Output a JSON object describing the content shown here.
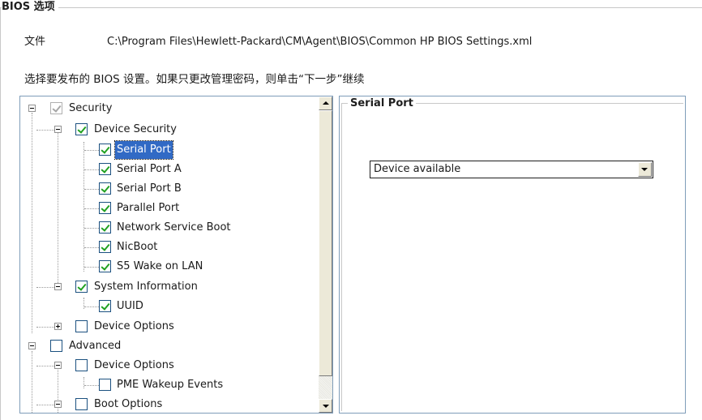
{
  "group_title": "BIOS 选项",
  "file": {
    "label": "文件",
    "path": "C:\\Program Files\\Hewlett-Packard\\CM\\Agent\\BIOS\\Common HP BIOS Settings.xml"
  },
  "instruction": "选择要发布的 BIOS 设置。如果只更改管理密码，则单击“下一步”继续",
  "tree": {
    "items": [
      {
        "label": "Security",
        "checked": true,
        "expanded": true
      },
      {
        "label": "Device Security",
        "checked": true,
        "expanded": true
      },
      {
        "label": "Serial Port",
        "checked": true,
        "selected": true
      },
      {
        "label": "Serial Port A",
        "checked": true
      },
      {
        "label": "Serial Port B",
        "checked": true
      },
      {
        "label": "Parallel Port",
        "checked": true
      },
      {
        "label": "Network Service Boot",
        "checked": true
      },
      {
        "label": "NicBoot",
        "checked": true
      },
      {
        "label": "S5 Wake on LAN",
        "checked": true
      },
      {
        "label": "System Information",
        "checked": true,
        "expanded": true
      },
      {
        "label": "UUID",
        "checked": true
      },
      {
        "label": "Device Options",
        "checked": false,
        "expanded": false
      },
      {
        "label": "Advanced",
        "checked": false,
        "expanded": true
      },
      {
        "label": "Device Options",
        "checked": false,
        "expanded": true
      },
      {
        "label": "PME Wakeup Events",
        "checked": false
      },
      {
        "label": "Boot Options",
        "checked": false,
        "expanded": true
      }
    ]
  },
  "detail": {
    "title": "Serial Port",
    "selected_value": "Device available"
  }
}
